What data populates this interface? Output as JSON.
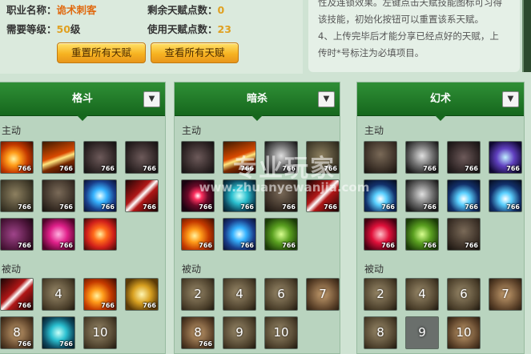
{
  "info": {
    "class_label": "职业名称：",
    "class_value": "诡术刺客",
    "remain_label": "剩余天赋点数：",
    "remain_value": "0",
    "level_label": "需要等级：",
    "level_value": "50",
    "level_unit": "级",
    "used_label": "使用天赋点数：",
    "used_value": "23",
    "reset_button": "重置所有天赋",
    "view_button": "查看所有天赋"
  },
  "notes": [
    "性及连锁效果。左键点击天赋技能图标可习得",
    "该技能，初始化按钮可以重置该系天赋。",
    "4、上传完毕后才能分享已经点好的天赋，上",
    "传时*号标注为必填项目。"
  ],
  "watermark": {
    "main": "专业玩家",
    "url": "www.zhuanyewanjia.com"
  },
  "panels": [
    {
      "title": "格斗",
      "active_label": "主动",
      "passive_label": "被动",
      "active": [
        {
          "icon": "fire-strike-icon",
          "style": "c-fire",
          "badge": "766"
        },
        {
          "icon": "sword-slash-icon",
          "style": "c-blade",
          "badge": "766"
        },
        {
          "icon": "dark-swirl-icon",
          "style": "c-dark",
          "badge": "766"
        },
        {
          "icon": "shadow-claw-icon",
          "style": "c-dark",
          "badge": "766"
        },
        {
          "icon": "chain-hook-icon",
          "style": "c-rope",
          "badge": "766"
        },
        {
          "icon": "shadow-figure-icon",
          "style": "c-shadow",
          "badge": "766"
        },
        {
          "icon": "blue-dagger-icon",
          "style": "c-blue",
          "badge": "766"
        },
        {
          "icon": "red-blade-icon",
          "style": "c-redblade",
          "badge": "766"
        },
        {
          "icon": "purple-mist-icon",
          "style": "c-purple",
          "badge": "766"
        },
        {
          "icon": "pink-dagger-icon",
          "style": "c-pink",
          "badge": "766"
        },
        {
          "icon": "fire-swirl-icon",
          "style": "c-swirl",
          "badge": ""
        }
      ],
      "passive": [
        {
          "icon": "red-sword-icon",
          "style": "c-redblade",
          "badge": "766",
          "num": ""
        },
        {
          "icon": "passive-icon",
          "style": "c-stone",
          "badge": "",
          "num": "4"
        },
        {
          "icon": "red-warrior-icon",
          "style": "c-fire",
          "badge": "766",
          "num": ""
        },
        {
          "icon": "gold-warrior-icon",
          "style": "c-gold",
          "badge": "766",
          "num": ""
        },
        {
          "icon": "passive-icon",
          "style": "c-brown",
          "badge": "766",
          "num": "8"
        },
        {
          "icon": "cyan-burst-icon",
          "style": "c-cyan",
          "badge": "766",
          "num": ""
        },
        {
          "icon": "passive-icon",
          "style": "c-stone",
          "badge": "",
          "num": "10"
        }
      ]
    },
    {
      "title": "暗杀",
      "active_label": "主动",
      "passive_label": "被动",
      "active": [
        {
          "icon": "shadow-strike-icon",
          "style": "c-dark",
          "badge": ""
        },
        {
          "icon": "golden-slash-icon",
          "style": "c-blade",
          "badge": "766"
        },
        {
          "icon": "ghost-icon",
          "style": "c-ghost",
          "badge": "766"
        },
        {
          "icon": "rope-icon",
          "style": "c-rope",
          "badge": "766"
        },
        {
          "icon": "target-icon",
          "style": "c-target",
          "badge": "766"
        },
        {
          "icon": "cyan-figure-icon",
          "style": "c-cyan",
          "badge": "766"
        },
        {
          "icon": "dark-beast-icon",
          "style": "c-shadow",
          "badge": "766"
        },
        {
          "icon": "red-mark-icon",
          "style": "c-redblade",
          "badge": "766"
        },
        {
          "icon": "crossed-blades-icon",
          "style": "c-fire",
          "badge": "766"
        },
        {
          "icon": "blue-blade-icon",
          "style": "c-blue",
          "badge": "766"
        },
        {
          "icon": "shadow-clones-icon",
          "style": "c-green",
          "badge": "766"
        }
      ],
      "passive": [
        {
          "icon": "passive-icon",
          "style": "c-stone",
          "badge": "",
          "num": "2"
        },
        {
          "icon": "passive-icon",
          "style": "c-stone",
          "badge": "",
          "num": "4"
        },
        {
          "icon": "passive-icon",
          "style": "c-stone",
          "badge": "",
          "num": "6"
        },
        {
          "icon": "passive-icon",
          "style": "c-brown",
          "badge": "",
          "num": "7"
        },
        {
          "icon": "passive-icon",
          "style": "c-brown",
          "badge": "766",
          "num": "8"
        },
        {
          "icon": "passive-icon",
          "style": "c-stone",
          "badge": "",
          "num": "9"
        },
        {
          "icon": "passive-icon",
          "style": "c-stone",
          "badge": "",
          "num": "10"
        }
      ]
    },
    {
      "title": "幻术",
      "active_label": "主动",
      "passive_label": "被动",
      "active": [
        {
          "icon": "dark-hand-icon",
          "style": "c-shadow",
          "badge": ""
        },
        {
          "icon": "shadow-walk-icon",
          "style": "c-ghost",
          "badge": "766"
        },
        {
          "icon": "crescent-icon",
          "style": "c-dark",
          "badge": "766"
        },
        {
          "icon": "demon-face-icon",
          "style": "c-face",
          "badge": "766"
        },
        {
          "icon": "blue-spirit-icon",
          "style": "c-blueglow",
          "badge": "766"
        },
        {
          "icon": "skull-icon",
          "style": "c-ghost",
          "badge": "766"
        },
        {
          "icon": "blue-head-icon",
          "style": "c-blueglow",
          "badge": "766"
        },
        {
          "icon": "halo-head-icon",
          "style": "c-blueglow",
          "badge": "766"
        },
        {
          "icon": "red-skull-icon",
          "style": "c-skull",
          "badge": "766"
        },
        {
          "icon": "green-figure-icon",
          "style": "c-green",
          "badge": "766"
        },
        {
          "icon": "dark-orb-icon",
          "style": "c-shadow",
          "badge": "766"
        }
      ],
      "passive": [
        {
          "icon": "passive-icon",
          "style": "c-stone",
          "badge": "",
          "num": "2"
        },
        {
          "icon": "passive-icon",
          "style": "c-stone",
          "badge": "",
          "num": "4"
        },
        {
          "icon": "passive-icon",
          "style": "c-stone",
          "badge": "",
          "num": "6"
        },
        {
          "icon": "passive-icon",
          "style": "c-brown",
          "badge": "",
          "num": "7"
        },
        {
          "icon": "passive-icon",
          "style": "c-stone",
          "badge": "",
          "num": "8"
        },
        {
          "icon": "passive-icon",
          "style": "c-grey",
          "badge": "",
          "num": "9"
        },
        {
          "icon": "passive-icon",
          "style": "c-brown",
          "badge": "",
          "num": "10"
        }
      ]
    }
  ]
}
